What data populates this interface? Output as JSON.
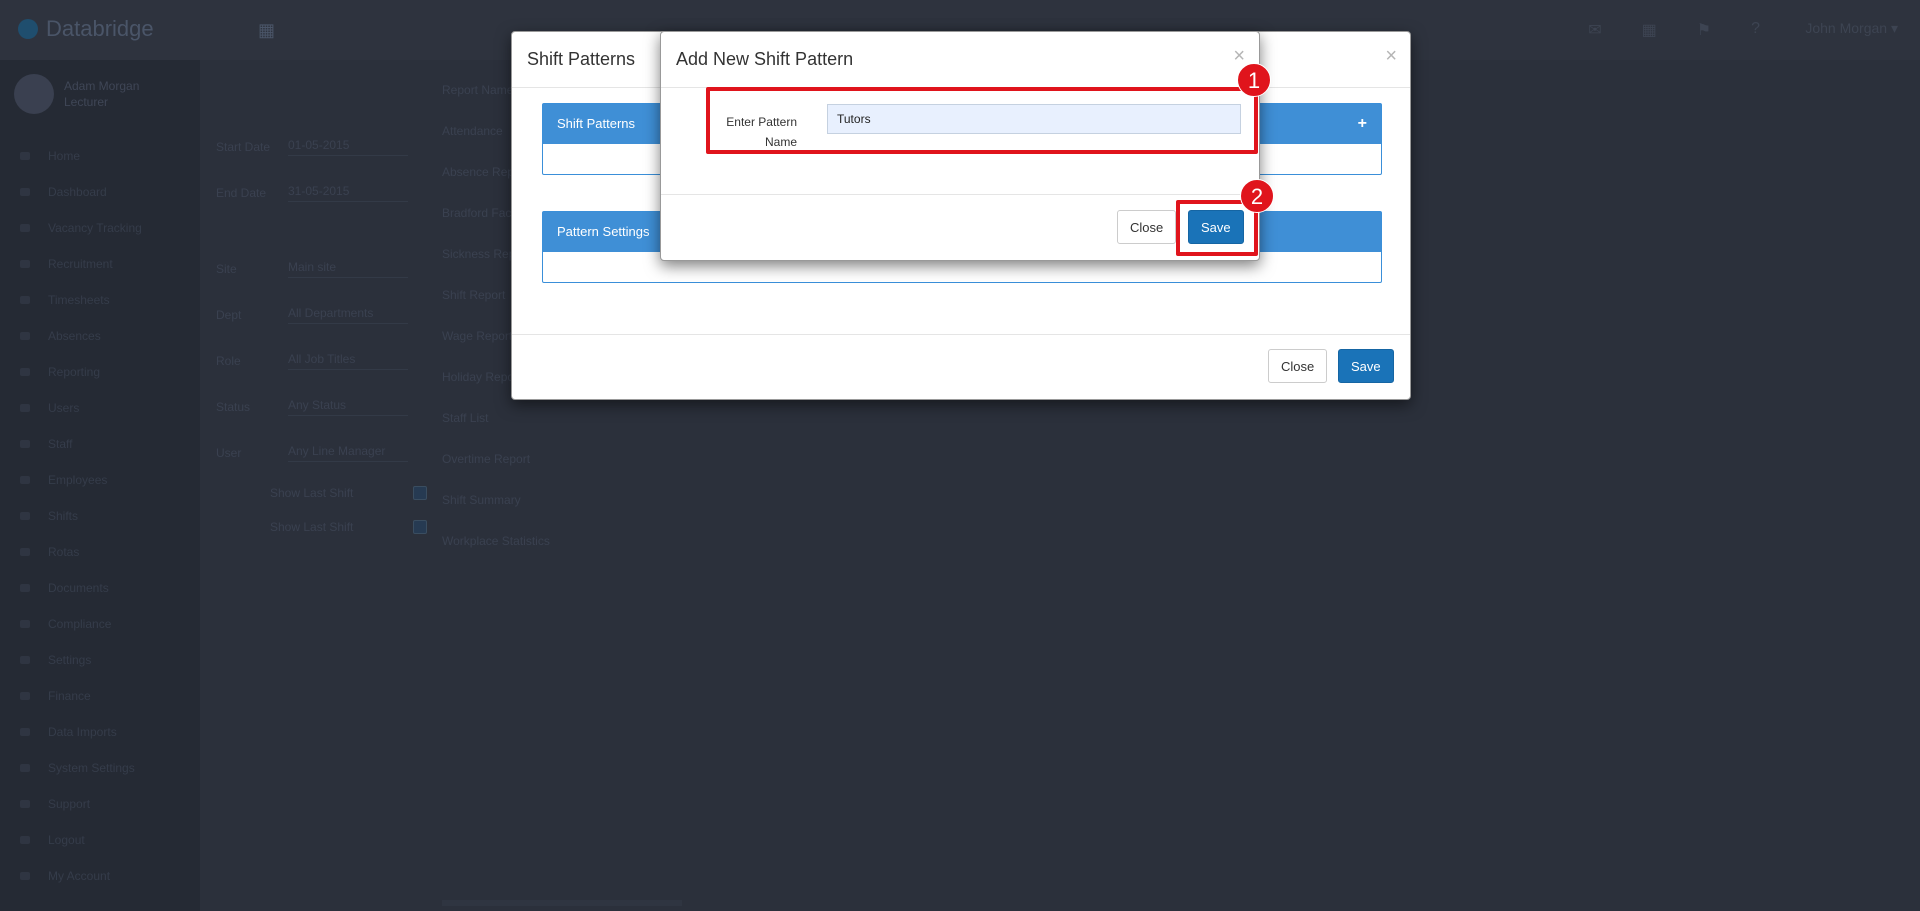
{
  "app": {
    "brand": "Databridge",
    "user_name": "John Morgan",
    "sidebar_user": [
      "Adam Morgan",
      "Lecturer"
    ],
    "sidebar_items": [
      "Home",
      "Dashboard",
      "Vacancy Tracking",
      "Recruitment",
      "Timesheets",
      "Absences",
      "Reporting",
      "Users",
      "Staff",
      "Employees",
      "Shifts",
      "Rotas",
      "Documents",
      "Compliance",
      "Settings",
      "Finance",
      "Data Imports",
      "System Settings",
      "Support",
      "Logout",
      "My Account"
    ],
    "filters": [
      {
        "label": "Start Date",
        "value": "01-05-2015"
      },
      {
        "label": "End Date",
        "value": "31-05-2015"
      },
      {
        "label": "Site",
        "value": "Main site"
      },
      {
        "label": "Dept",
        "value": "All Departments"
      },
      {
        "label": "Role",
        "value": "All Job Titles"
      },
      {
        "label": "Status",
        "value": "Any Status"
      },
      {
        "label": "User",
        "value": "Any Line Manager"
      }
    ],
    "filter_checks": [
      "Show Last Shift",
      "Show Last Shift"
    ],
    "report_list_header": "Report Name",
    "report_list": [
      "Attendance",
      "Absence Report",
      "Bradford Factor",
      "Sickness Report",
      "Shift Report",
      "Wage Report",
      "Holiday Report",
      "Staff List",
      "Overtime Report",
      "Shift Summary",
      "Workplace Statistics"
    ]
  },
  "shift_patterns_modal": {
    "title": "Shift Patterns",
    "close_symbol": "×",
    "panels": [
      {
        "title": "Shift Patterns",
        "add_symbol": "+"
      },
      {
        "title": "Pattern Settings"
      }
    ],
    "footer": {
      "close_label": "Close",
      "save_label": "Save"
    }
  },
  "add_pattern_modal": {
    "title": "Add New Shift Pattern",
    "close_symbol": "×",
    "field_label": "Enter Pattern Name",
    "field_value": "Tutors",
    "footer": {
      "close_label": "Close",
      "save_label": "Save"
    }
  },
  "annotations": [
    {
      "label": "1",
      "target": "pattern-name-field"
    },
    {
      "label": "2",
      "target": "save-button"
    }
  ],
  "colors": {
    "highlight": "#e0141c",
    "panel_header": "#3f8fd6",
    "primary_button": "#1a73b8"
  }
}
